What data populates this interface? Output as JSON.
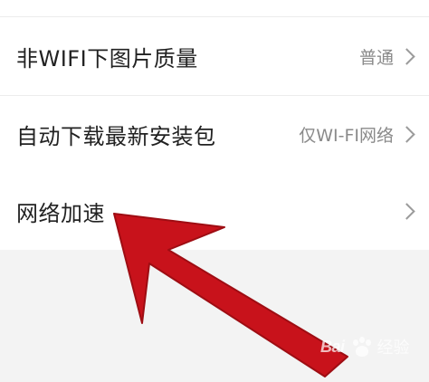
{
  "settings": {
    "items": [
      {
        "label": "非WIFI下图片质量",
        "value": "普通"
      },
      {
        "label": "自动下载最新安装包",
        "value": "仅WI-FI网络"
      },
      {
        "label": "网络加速",
        "value": ""
      }
    ]
  },
  "watermark": {
    "brand": "Bai",
    "suffix": "经验"
  },
  "colors": {
    "background": "#f3f3f3",
    "row_background": "#ffffff",
    "text_primary": "#222222",
    "text_secondary": "#8a8a8a",
    "arrow": "#c8121b"
  },
  "icons": {
    "chevron": "chevron-right-icon",
    "arrow": "arrow-annotation-icon",
    "watermark": "paw-icon"
  }
}
